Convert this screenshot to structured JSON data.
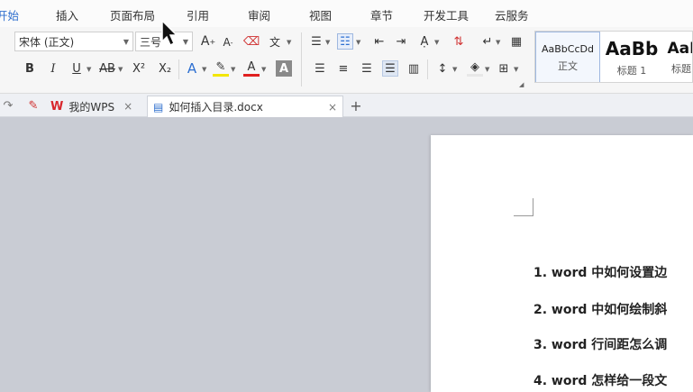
{
  "menu": {
    "tabs": [
      {
        "label": "开始",
        "active": true
      },
      {
        "label": "插入",
        "active": false
      },
      {
        "label": "页面布局",
        "active": false
      },
      {
        "label": "引用",
        "active": false
      },
      {
        "label": "审阅",
        "active": false
      },
      {
        "label": "视图",
        "active": false
      },
      {
        "label": "章节",
        "active": false
      },
      {
        "label": "开发工具",
        "active": false
      },
      {
        "label": "云服务",
        "active": false
      }
    ]
  },
  "ribbon": {
    "font_name": "宋体 (正文)",
    "font_size": "三号",
    "grow_font": "A",
    "shrink_font": "A",
    "bold": "B",
    "italic": "I",
    "underline": "U",
    "strike": "AB",
    "superscript": "X²",
    "subscript": "X₂",
    "pinyin": "文",
    "text_effect": "A",
    "font_color": "A",
    "char_shading": "A"
  },
  "styles_gallery": {
    "items": [
      {
        "sample": "AaBbCcDd",
        "caption": "正文"
      },
      {
        "sample": "AaBb",
        "caption": "标题 1"
      },
      {
        "sample": "AaI",
        "caption": "标题"
      }
    ]
  },
  "doc_tabs": {
    "home_label": "我的WPS",
    "file_label": "如何插入目录.docx",
    "add_symbol": "+",
    "close_symbol": "×"
  },
  "document": {
    "lines": [
      "1. word 中如何设置边",
      "2. word 中如何绘制斜",
      "3. word 行间距怎么调",
      "4. word 怎样给一段文"
    ]
  },
  "colors": {
    "accent": "#2f6fce",
    "wps_red": "#d8262c",
    "workspace": "#c9ccd4"
  }
}
